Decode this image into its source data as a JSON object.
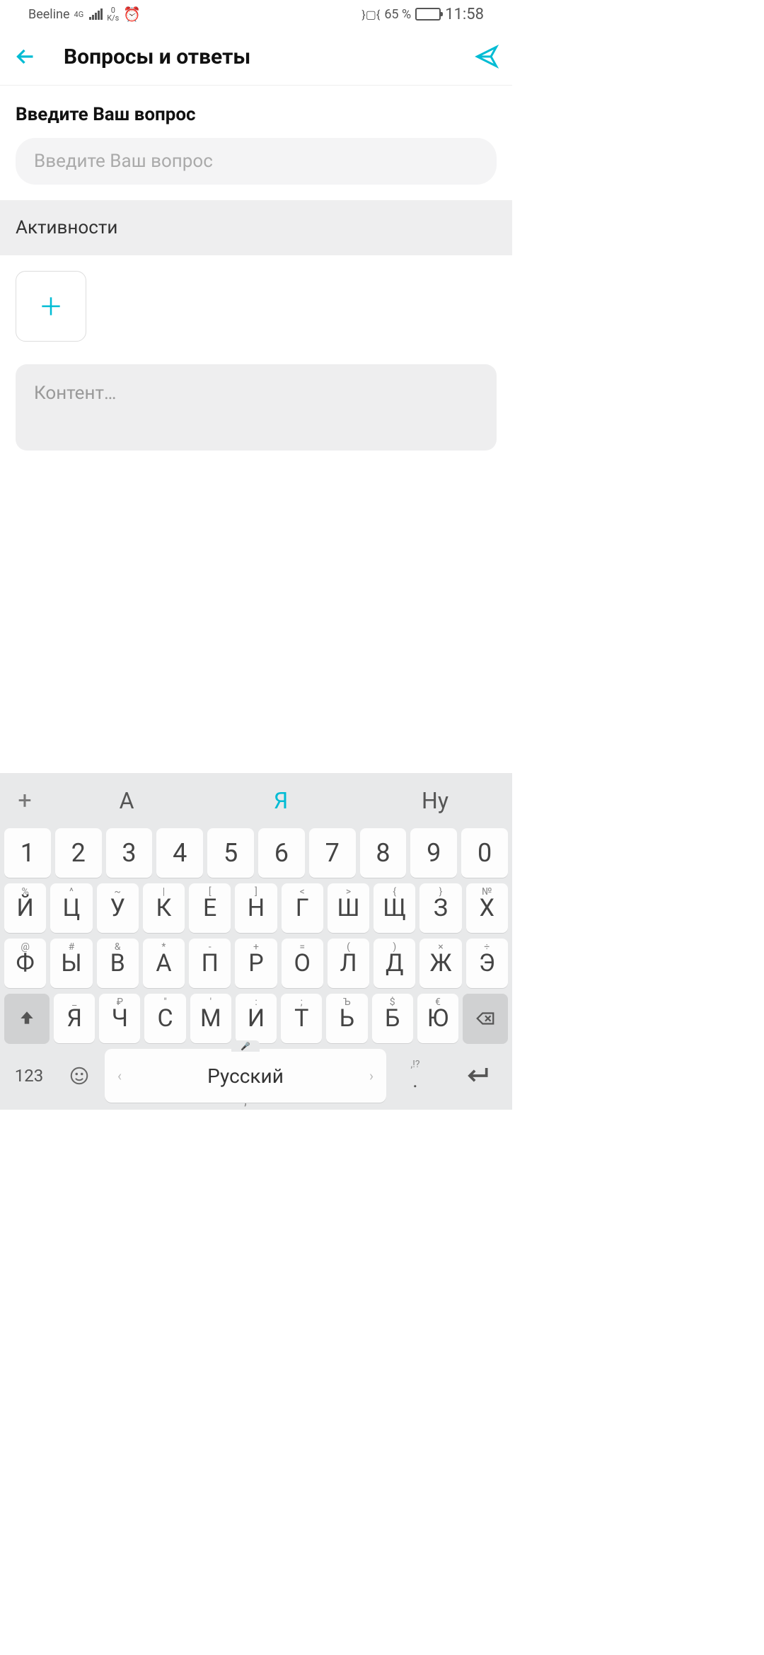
{
  "status": {
    "carrier": "Beeline",
    "network": "4G",
    "data_top": "0",
    "data_unit": "K/s",
    "vibrate": "⬚",
    "battery_pct": "65 %",
    "time": "11:58"
  },
  "header": {
    "title": "Вопросы и ответы"
  },
  "form": {
    "question_label": "Введите Ваш вопрос",
    "question_placeholder": "Введите Ваш вопрос",
    "activities_label": "Активности",
    "content_placeholder": "Контент…"
  },
  "keyboard": {
    "suggestions": [
      "А",
      "Я",
      "Ну"
    ],
    "row_num": [
      "1",
      "2",
      "3",
      "4",
      "5",
      "6",
      "7",
      "8",
      "9",
      "0"
    ],
    "row1_sup": [
      "%",
      "^",
      "~",
      "|",
      "[",
      "]",
      "<",
      ">",
      "{",
      "}",
      "№"
    ],
    "row1": [
      "Й",
      "Ц",
      "У",
      "К",
      "Е",
      "Н",
      "Г",
      "Ш",
      "Щ",
      "З",
      "Х"
    ],
    "row2_sup": [
      "@",
      "#",
      "&",
      "*",
      "-",
      "+",
      "=",
      "(",
      ")",
      "×",
      "÷"
    ],
    "row2": [
      "Ф",
      "Ы",
      "В",
      "А",
      "П",
      "Р",
      "О",
      "Л",
      "Д",
      "Ж",
      "Э"
    ],
    "row3_sup": [
      "_",
      "₽",
      "\"",
      "'",
      ":",
      ";",
      "Ъ",
      "$",
      "€"
    ],
    "row3": [
      "Я",
      "Ч",
      "С",
      "М",
      "И",
      "Т",
      "Ь",
      "Б",
      "Ю"
    ],
    "mode_key": "123",
    "language": "Русский",
    "punct_key": ",!?\n.",
    "punct_display": ",!?"
  }
}
